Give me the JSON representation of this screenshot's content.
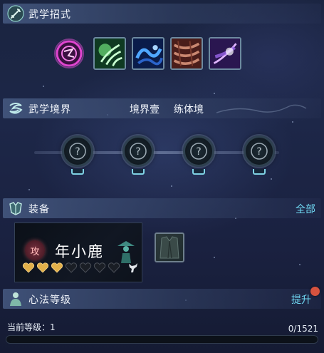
{
  "martial_moves": {
    "title": "武学招式",
    "icon": "sword-icon",
    "skills": [
      {
        "name": "purple-sigil-skill-icon",
        "color": "#c43ab4"
      },
      {
        "name": "green-claw-skill-icon",
        "color": "#3e9e3c"
      },
      {
        "name": "blue-serpent-skill-icon",
        "color": "#2d6fd0"
      },
      {
        "name": "red-chain-skill-icon",
        "color": "#9a4a3c"
      },
      {
        "name": "violet-strike-skill-icon",
        "color": "#8b4fd6"
      }
    ]
  },
  "martial_realm": {
    "title": "武学境界",
    "icon": "swirl-icon",
    "realm": "境界壹",
    "stage": "练体境",
    "nodes": [
      {
        "icon": "locked-swirl-icon",
        "symbol": "?"
      },
      {
        "icon": "locked-swirl-icon",
        "symbol": "?"
      },
      {
        "icon": "locked-swirl-icon",
        "symbol": "?"
      },
      {
        "icon": "locked-swirl-icon",
        "symbol": "?"
      }
    ]
  },
  "equipment": {
    "title": "装备",
    "icon": "armor-icon",
    "all_label": "全部",
    "character": {
      "type_badge": "攻",
      "name": "年小鹿",
      "hearts_filled": 3,
      "hearts_total": 7
    },
    "slot_icon": "robe-icon"
  },
  "mind_method": {
    "title": "心法等级",
    "icon": "monk-icon",
    "upgrade_label": "提升",
    "level_label": "当前等级：1",
    "progress_text": "0/1521",
    "progress_fraction": 0.0,
    "accent_color": "#6fd7f2",
    "notification_color": "#d6533f"
  }
}
